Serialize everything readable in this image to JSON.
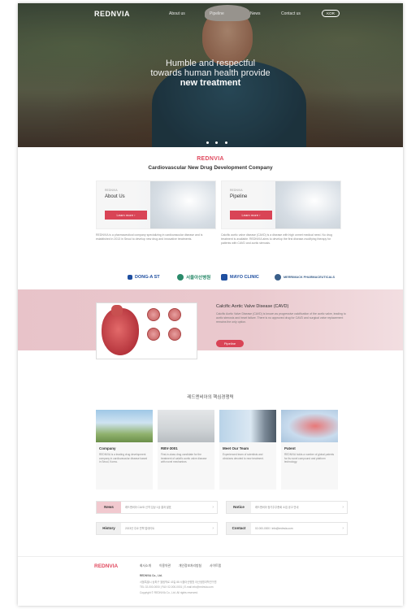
{
  "nav": {
    "logo": "REDNVIA",
    "items": [
      "About us",
      "Pipeline",
      "News",
      "Contact us"
    ],
    "lang_button": "KOR"
  },
  "hero": {
    "line1": "Humble and respectful",
    "line2": "towards human health provide",
    "line3": "new treatment"
  },
  "intro": {
    "brand": "REDNVIA",
    "title": "Cardiovascular New Drug Development Company",
    "cards": [
      {
        "small": "REDNVIA",
        "title": "About Us",
        "button": "Learn more"
      },
      {
        "small": "REDNVIA",
        "title": "Pipeline",
        "button": "Learn more"
      }
    ],
    "descriptions": [
      "REDNVIA is a pharmaceutical company specializing in cardiovascular disease and is established in 2013 in Seoul to develop new drug and innovative treatments.",
      "Calcific aortic valve disease (CAVD) is a disease with high unmet medical need. No drug treatment is available. REDNVIA aims to develop the first disease-modifying therapy for patients with CAVD and aortic stenosis."
    ]
  },
  "partners": [
    {
      "name": "DONG-A ST",
      "color": "#1f4fa0"
    },
    {
      "name": "서울아산병원",
      "color": "#2a8a6a"
    },
    {
      "name": "MAYO CLINIC",
      "color": "#1f4fa0"
    },
    {
      "name": "MERRIMACK PHARMACEUTICALS",
      "color": "#3a5f8a"
    }
  ],
  "cavd": {
    "title": "Calcific Aortic Valve Disease (CAVD)",
    "description": "Calcific Aortic Valve Disease (CAVD) is known as progressive calcification of the aortic valve, leading to aortic stenosis and heart failure. There is no approved drug for CAVD and surgical valve replacement remains the only option.",
    "button": "Pipeline"
  },
  "core": {
    "title": "레드엔비아의 핵심경쟁력",
    "tiles": [
      {
        "title": "Company",
        "desc": "REDNVIA is a leading drug development company in cardiovascular disease based in Seoul, Korea."
      },
      {
        "title": "RBV-3001",
        "desc": "First-in-class drug candidate for the treatment of calcific aortic valve disease with novel mechanism."
      },
      {
        "title": "Meet Our Team",
        "desc": "Experienced team of scientists and clinicians devoted to new treatment."
      },
      {
        "title": "Patent",
        "desc": "REDNVIA holds a number of global patents for its novel compound and platform technology."
      }
    ]
  },
  "rows": [
    {
      "label": "News",
      "text": "레드엔비아 CAVD 신약 임상 1상 결과 발표",
      "style": "pink"
    },
    {
      "label": "Notice",
      "text": "레드엔비아 정기주주총회 소집 공고 안내",
      "style": "grey"
    },
    {
      "label": "History",
      "text": "2023년 주요 연혁 업데이트",
      "style": "grey"
    },
    {
      "label": "Contact",
      "text": "02-000-0000 / info@rednvia.com",
      "style": "grey"
    }
  ],
  "footer": {
    "logo": "REDNVIA",
    "links": [
      "회사소개",
      "이용약관",
      "개인정보처리방침",
      "사이트맵"
    ],
    "lines": [
      "REDNVIA Co., Ltd.",
      "서울특별시 송파구 올림픽로 43길 88 서울아산병원 아산생명과학연구원",
      "TEL 02-000-0000 | FAX 02-000-0001 | E-mail info@rednvia.com",
      "Copyright © REDNVIA Co., Ltd. All rights reserved."
    ]
  }
}
